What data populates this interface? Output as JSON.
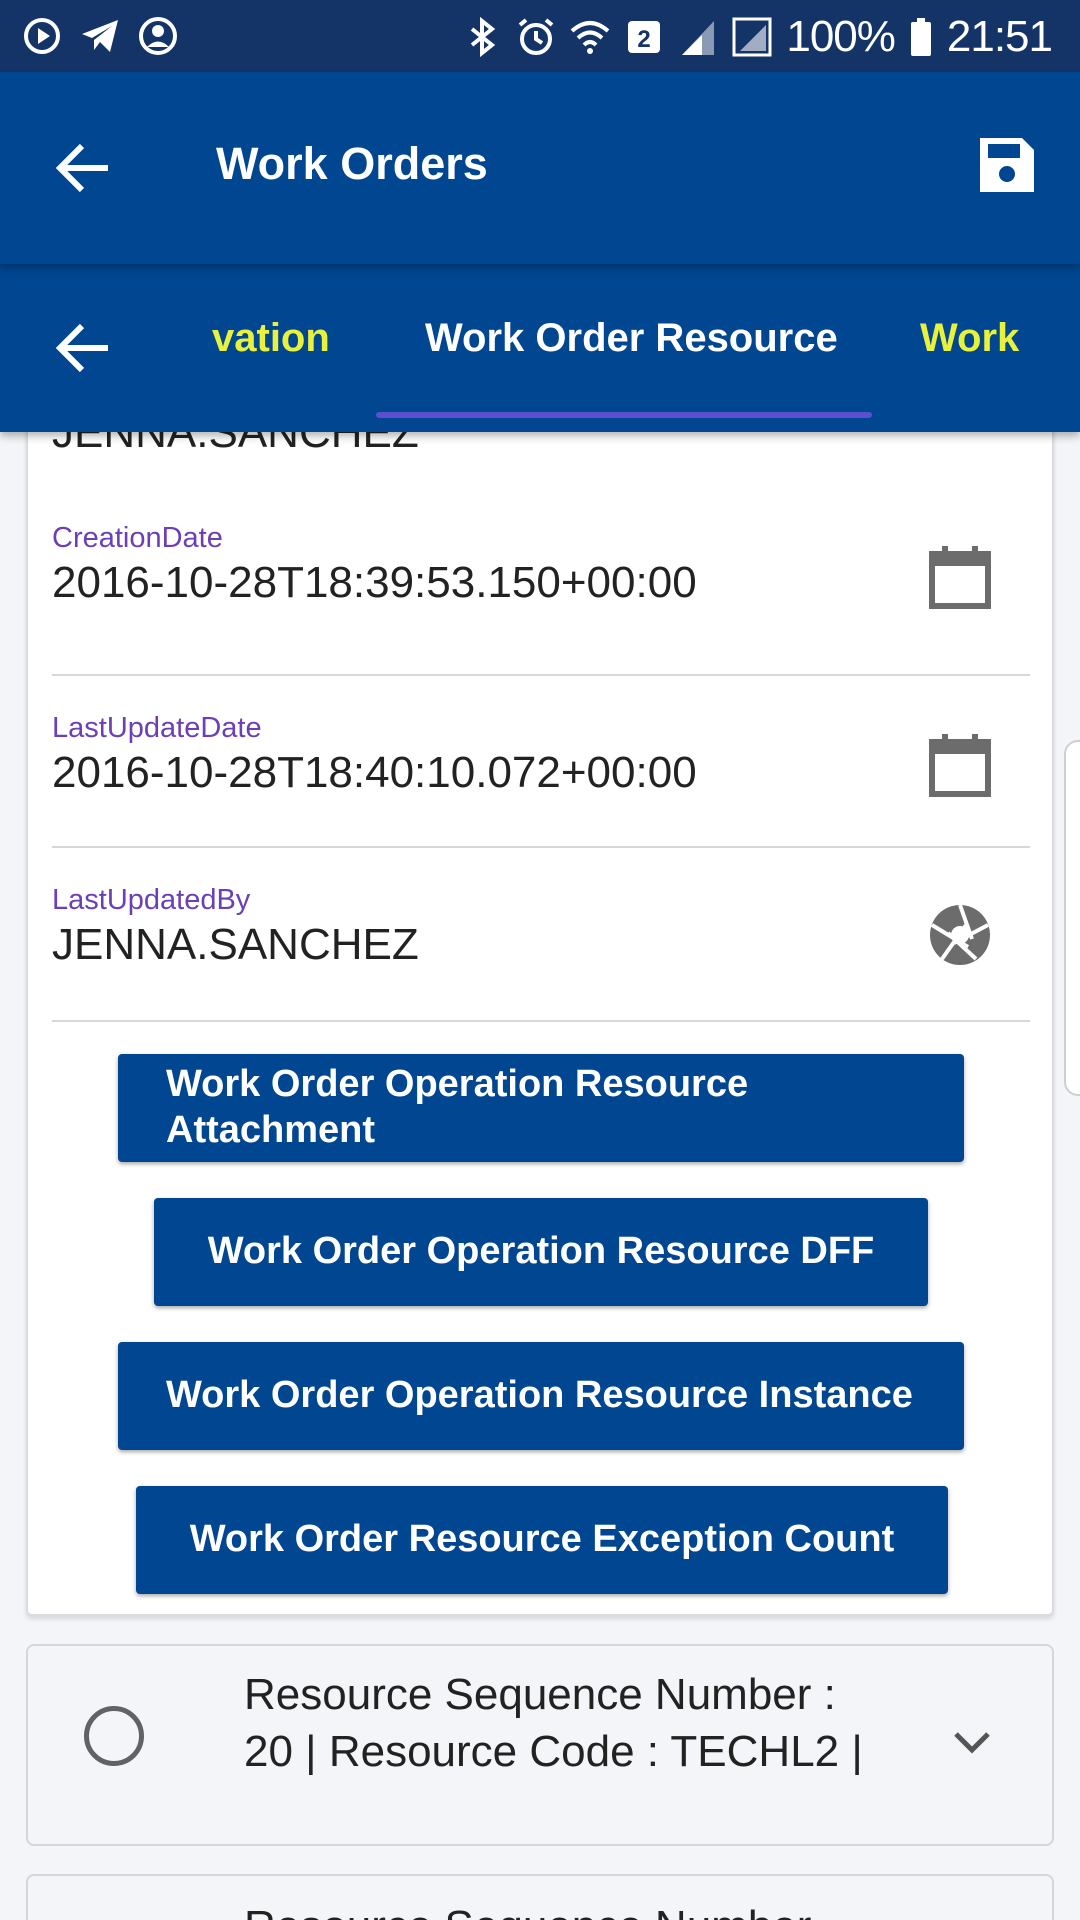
{
  "status_bar": {
    "left_icons": [
      "media-play-icon",
      "telegram-icon",
      "account-icon"
    ],
    "right_icons": [
      "bluetooth-icon",
      "alarm-icon",
      "wifi-icon",
      "sim2-icon",
      "signal-icon",
      "signal-r-icon"
    ],
    "battery": "100%",
    "time": "21:51"
  },
  "app_bar": {
    "title": "Work Orders",
    "back_icon": "arrow-back-icon",
    "action_icon": "save-icon"
  },
  "tabs": {
    "items": [
      {
        "label": "vation",
        "state": "partial"
      },
      {
        "label": "Work Order Resource",
        "state": "active"
      },
      {
        "label": "Work O",
        "state": "partial"
      }
    ],
    "active_color": "#ffffff",
    "inactive_color": "#e8f23c"
  },
  "detail": {
    "peek_value": "JENNA.SANCHEZ",
    "fields": [
      {
        "label": "CreationDate",
        "value": "2016-10-28T18:39:53.150+00:00",
        "icon": "calendar-icon"
      },
      {
        "label": "LastUpdateDate",
        "value": "2016-10-28T18:40:10.072+00:00",
        "icon": "calendar-icon"
      },
      {
        "label": "LastUpdatedBy",
        "value": "JENNA.SANCHEZ",
        "icon": "aperture-icon"
      }
    ],
    "buttons": [
      "Work Order Operation Resource Attachment",
      "Work Order Operation Resource DFF",
      "Work Order Operation Resource Instance",
      "Work Order Resource Exception Count"
    ]
  },
  "list": {
    "items": [
      {
        "text": "Resource Sequence Number : 20 | Resource Code : TECHL2 |"
      },
      {
        "text": "Resource Sequence Number"
      }
    ]
  },
  "colors": {
    "primary": "#004690",
    "status_bar": "#143468",
    "label": "#6a3fb8",
    "tab_indicator": "#5b4fd0"
  }
}
